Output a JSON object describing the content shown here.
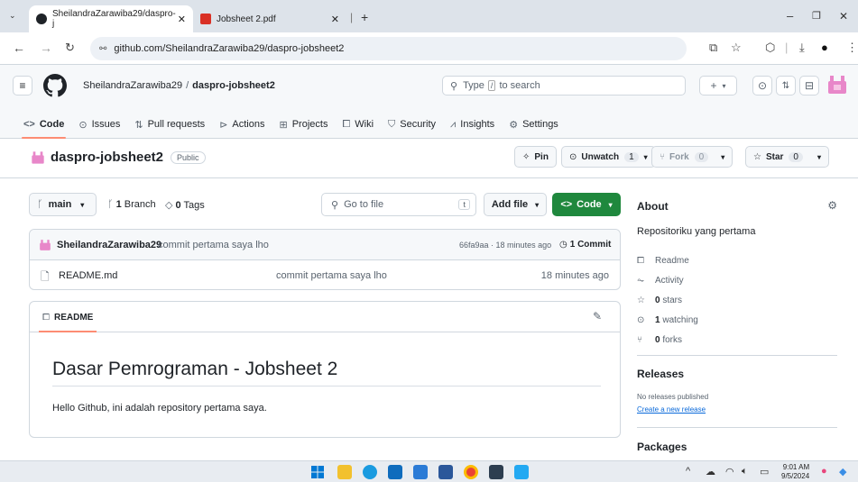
{
  "browser": {
    "tabs": [
      {
        "title": "SheilandraZarawiba29/daspro-j",
        "active": true
      },
      {
        "title": "Jobsheet 2.pdf",
        "active": false
      }
    ],
    "url": "github.com/SheilandraZarawiba29/daspro-jobsheet2"
  },
  "header": {
    "owner": "SheilandraZarawiba29",
    "separator": "/",
    "repo": "daspro-jobsheet2",
    "search_prefix": "Type",
    "search_key": "/",
    "search_suffix": "to search"
  },
  "reponav": [
    {
      "label": "Code",
      "icon": "code-icon",
      "selected": true
    },
    {
      "label": "Issues",
      "icon": "issue-icon"
    },
    {
      "label": "Pull requests",
      "icon": "pull-request-icon"
    },
    {
      "label": "Actions",
      "icon": "play-icon"
    },
    {
      "label": "Projects",
      "icon": "table-icon"
    },
    {
      "label": "Wiki",
      "icon": "book-icon"
    },
    {
      "label": "Security",
      "icon": "shield-icon"
    },
    {
      "label": "Insights",
      "icon": "graph-icon"
    },
    {
      "label": "Settings",
      "icon": "gear-icon"
    }
  ],
  "repo_title": {
    "name": "daspro-jobsheet2",
    "visibility": "Public",
    "pin_label": "Pin",
    "unwatch_label": "Unwatch",
    "unwatch_count": "1",
    "fork_label": "Fork",
    "fork_count": "0",
    "star_label": "Star",
    "star_count": "0"
  },
  "code_area": {
    "branch": "main",
    "branch_count": "1",
    "branch_word": "Branch",
    "tag_count": "0",
    "tag_word": "Tags",
    "goto_placeholder": "Go to file",
    "goto_key": "t",
    "add_file_label": "Add file",
    "code_button_label": "Code"
  },
  "latest_commit": {
    "author": "SheilandraZarawiba29",
    "message": "commit pertama saya lho",
    "hash": "66fa9aa",
    "age": "18 minutes ago",
    "count_label": "1 Commit"
  },
  "files": [
    {
      "name": "README.md",
      "message": "commit pertama saya lho",
      "age": "18 minutes ago"
    }
  ],
  "readme": {
    "tab_label": "README",
    "heading": "Dasar Pemrograman - Jobsheet 2",
    "body": "Hello Github, ini adalah repository pertama saya."
  },
  "about": {
    "title": "About",
    "description": "Repositoriku yang pertama",
    "items": [
      {
        "icon": "book-icon",
        "text": "Readme"
      },
      {
        "icon": "pulse-icon",
        "text": "Activity"
      },
      {
        "icon": "star-icon",
        "count": "0",
        "text": "stars"
      },
      {
        "icon": "eye-icon",
        "count": "1",
        "text": "watching"
      },
      {
        "icon": "fork-icon",
        "count": "0",
        "text": "forks"
      }
    ]
  },
  "releases": {
    "title": "Releases",
    "none_text": "No releases published",
    "create_link": "Create a new release"
  },
  "packages": {
    "title": "Packages"
  },
  "taskbar": {
    "time": "9:01 AM",
    "date": "9/5/2024"
  },
  "colors": {
    "code_button": "#1f883d",
    "nav_underline": "#fd8c73",
    "link": "#0969da"
  }
}
